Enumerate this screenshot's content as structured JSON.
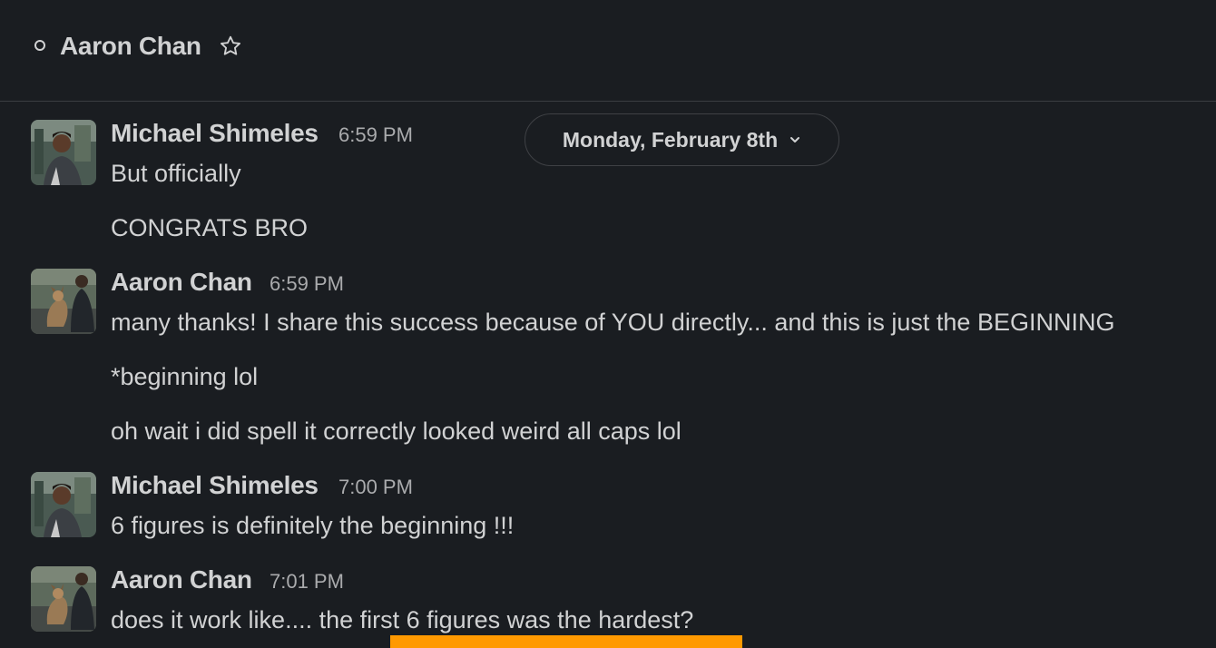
{
  "header": {
    "title": "Aaron Chan",
    "presence": "offline",
    "star_icon": "star-outline-icon"
  },
  "date_divider": {
    "label": "Monday, February 8th",
    "icon": "chevron-down-icon"
  },
  "messages": [
    {
      "sender": "Michael Shimeles",
      "time": "6:59 PM",
      "lines": [
        "But officially",
        "CONGRATS BRO"
      ]
    },
    {
      "sender": "Aaron Chan",
      "time": "6:59 PM",
      "lines": [
        "many thanks! I share this success because of YOU directly... and this is just the BEGINNING",
        "*beginning lol",
        "oh wait i did spell it correctly looked weird all caps lol"
      ]
    },
    {
      "sender": "Michael Shimeles",
      "time": "7:00 PM",
      "lines": [
        "6 figures is definitely the beginning !!!"
      ]
    },
    {
      "sender": "Aaron Chan",
      "time": "7:01 PM",
      "lines": [
        "does it work like.... the first 6 figures was the hardest?"
      ]
    }
  ],
  "colors": {
    "background": "#1a1d21",
    "text": "#d1d2d3",
    "timestamp": "#aaabad",
    "divider": "#3b3d42",
    "highlight": "#ff9900"
  }
}
